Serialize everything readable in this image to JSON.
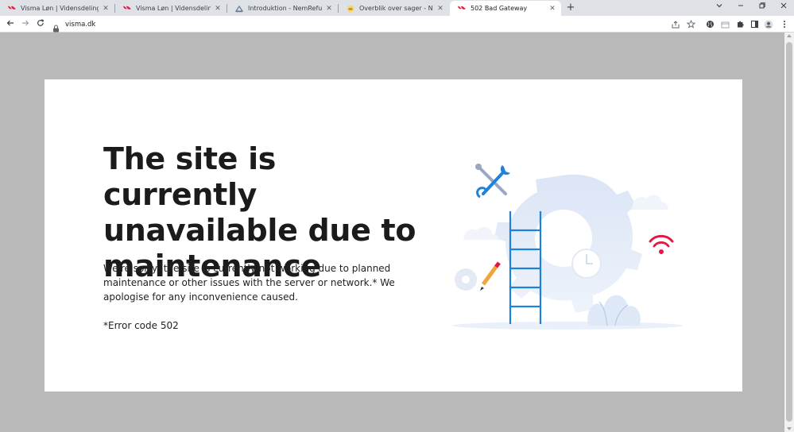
{
  "browser": {
    "tabs": [
      {
        "title": "Visma Løn | Vidensdeling & nyheder",
        "favicon": "visma-icon",
        "active": false
      },
      {
        "title": "Visma Løn | Vidensdeling & nyheder",
        "favicon": "visma-icon",
        "active": false
      },
      {
        "title": "Introduktion - NemRefusion - Re",
        "favicon": "nemrefusion-icon",
        "active": false
      },
      {
        "title": "Overblik over sager - Nemrefusion",
        "favicon": "crown-icon",
        "active": false
      },
      {
        "title": "502 Bad Gateway",
        "favicon": "visma-icon",
        "active": true
      }
    ],
    "close_glyph": "✕",
    "new_tab_glyph": "+",
    "url": "visma.dk",
    "colors": {
      "tabstrip": "#dee1e6",
      "toolbar": "#ffffff",
      "page_backdrop": "#b9b9b9",
      "visma_red": "#d9213f"
    }
  },
  "page": {
    "headline": "The site is currently unavailable due to maintenance",
    "body": "We're sorry, the site is currently not working due to planned maintenance or other issues with the server or network.* We apologise for any inconvenience caused.",
    "error_code": "*Error code 502",
    "illustration": "maintenance-illustration",
    "colors": {
      "gear": "#dbe5f6",
      "ladder": "#1f82d9",
      "wifi": "#e0173f",
      "pencil": "#f2a33a",
      "text": "#1b1b1b"
    }
  }
}
